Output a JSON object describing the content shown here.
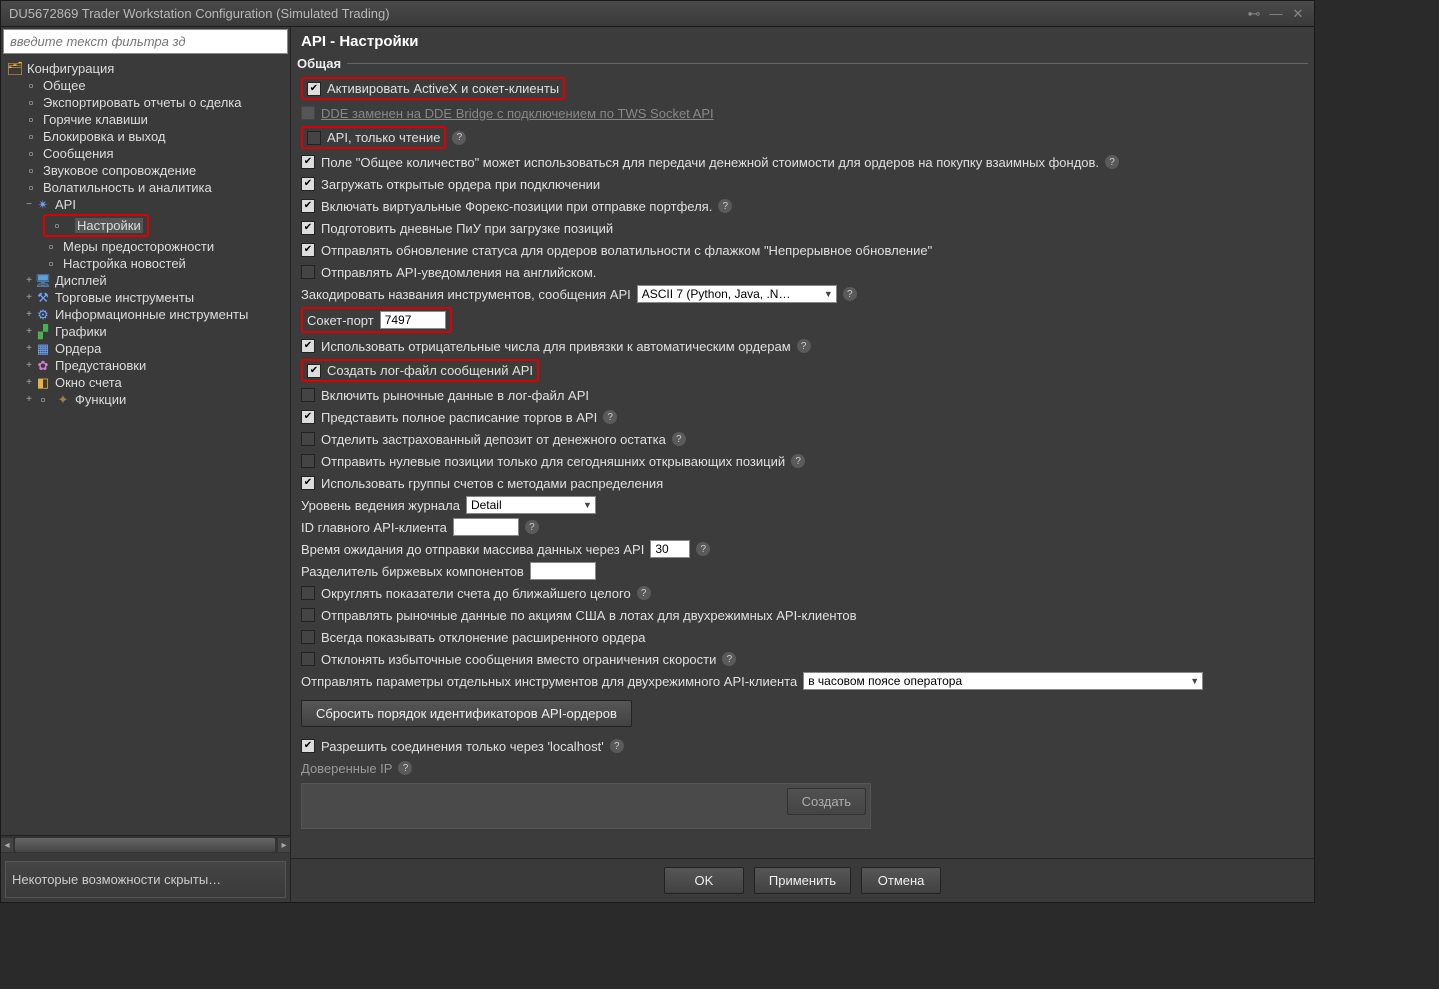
{
  "title": "DU5672869 Trader Workstation Configuration (Simulated Trading)",
  "filter_placeholder": "введите текст фильтра зд",
  "tree": {
    "root": "Конфигурация",
    "general": "Общее",
    "export": "Экспортировать отчеты о сделка",
    "hotkeys": "Горячие клавиши",
    "lock": "Блокировка и выход",
    "messages": "Сообщения",
    "sound": "Звуковое сопровождение",
    "volatility": "Волатильность и аналитика",
    "api": "API",
    "api_settings": "Настройки",
    "api_precautions": "Меры предосторожности",
    "api_news": "Настройка новостей",
    "display": "Дисплей",
    "trading": "Торговые инструменты",
    "info": "Информационные инструменты",
    "charts": "Графики",
    "orders": "Ордера",
    "presets": "Предустановки",
    "account": "Окно счета",
    "functions": "Функции"
  },
  "hidden_note": "Некоторые возможности скрыты…",
  "main_title": "API - Настройки",
  "section_general": "Общая",
  "rows": {
    "activex": "Активировать ActiveX и сокет-клиенты",
    "dde": "DDE заменен на DDE Bridge с подключением по TWS Socket API",
    "readonly": "API, только чтение",
    "total_qty": "Поле \"Общее количество\" может использоваться для передачи денежной стоимости для ордеров на покупку взаимных фондов.",
    "load_open": "Загружать открытые ордера при подключении",
    "virtual_fx": "Включать виртуальные Форекс-позиции при отправке портфеля.",
    "prepare_pnl": "Подготовить дневные ПиУ при загрузке позиций",
    "send_status": "Отправлять обновление статуса для ордеров волатильности с флажком \"Непрерывное обновление\"",
    "english": "Отправлять API-уведомления на английском.",
    "encode_label": "Закодировать названия инструментов, сообщения API",
    "encode_value": "ASCII 7 (Python, Java, .N…",
    "socket_port_label": "Сокет-порт",
    "socket_port_value": "7497",
    "neg_numbers": "Использовать отрицательные числа для привязки к автоматическим ордерам",
    "create_log": "Создать лог-файл сообщений API",
    "include_market": "Включить рыночные данные в лог-файл API",
    "full_schedule": "Представить полное расписание торгов в API",
    "separate_deposit": "Отделить застрахованный депозит от денежного остатка",
    "send_zero": "Отправить нулевые позиции только для сегодняшних открывающих позиций",
    "use_groups": "Использовать группы счетов с методами распределения",
    "log_level_label": "Уровень ведения журнала",
    "log_level_value": "Detail",
    "master_id_label": "ID главного API-клиента",
    "master_id_value": "",
    "timeout_label": "Время ожидания до отправки массива данных через API",
    "timeout_value": "30",
    "delimiter_label": "Разделитель биржевых компонентов",
    "delimiter_value": "",
    "round": "Округлять показатели счета до ближайшего целого",
    "us_lots": "Отправлять рыночные данные по акциям США в лотах для двухрежимных API-клиентов",
    "always_show": "Всегда показывать отклонение расширенного ордера",
    "reject_excess": "Отклонять избыточные сообщения вместо ограничения скорости",
    "send_params_label": "Отправлять параметры отдельных инструментов для двухрежимного API-клиента",
    "send_params_value": "в часовом поясе оператора",
    "reset_ids": "Сбросить порядок идентификаторов API-ордеров",
    "localhost": "Разрешить соединения только через 'localhost'",
    "trusted_ip": "Доверенные IP",
    "create": "Создать"
  },
  "footer": {
    "ok": "OK",
    "apply": "Применить",
    "cancel": "Отмена"
  }
}
